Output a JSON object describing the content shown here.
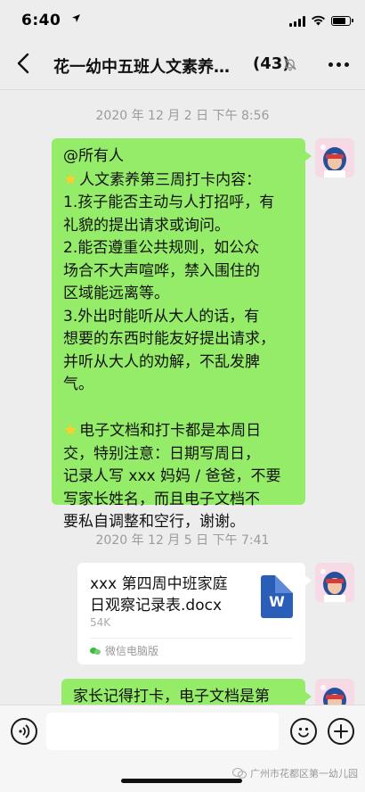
{
  "status_bar": {
    "time": "6:40",
    "location_icon": "location-arrow-icon"
  },
  "nav": {
    "title": "花一幼中五班人文素养…",
    "member_count": "(43)",
    "back_icon": "back-chevron-icon",
    "mute_icon": "mute-bell-icon",
    "more_icon": "more-dots-icon"
  },
  "chat": {
    "timestamp_1": "2020 年 12 月 2 日  下午 8:56",
    "message_1": {
      "lines": [
        "@所有人",
        "人文素养第三周打卡内容：",
        "1.孩子能否主动与人打招呼，有",
        "礼貌的提出请求或询问。",
        "2.能否遵重公共规则，如公众",
        "场合不大声喧哗，禁入围住的",
        "区域能远离等。",
        "3.外出时能听从大人的话，有",
        "想要的东西时能友好提出请求，",
        "并听从大人的劝解，不乱发脾",
        "气。",
        "",
        "电子文档和打卡都是本周日",
        "交，特别注意：日期写周日，",
        "记录人写 xxx 妈妈 / 爸爸，不要",
        "写家长姓名，而且电子文档不",
        "要私自调整和空行，谢谢。"
      ]
    },
    "timestamp_2": "2020 年 12 月 5 日  下午 7:41",
    "file": {
      "name_line_1": "xxx 第四周中班家庭",
      "name_line_2": "日观察记录表.docx",
      "size": "54K",
      "icon_letter": "W",
      "source": "微信电脑版"
    },
    "message_3": {
      "partial_text": "家长记得打卡，电子文档是第"
    }
  },
  "input_bar": {
    "placeholder": "",
    "voice_icon": "voice-icon",
    "emoji_icon": "emoji-icon",
    "plus_icon": "plus-icon"
  },
  "watermark": {
    "text": "广州市花都区第一幼儿园"
  },
  "colors": {
    "background": "#ededed",
    "bubble_green": "#95ec69",
    "timestamp": "#9b9b9b",
    "word_blue": "#2b5eb8"
  }
}
